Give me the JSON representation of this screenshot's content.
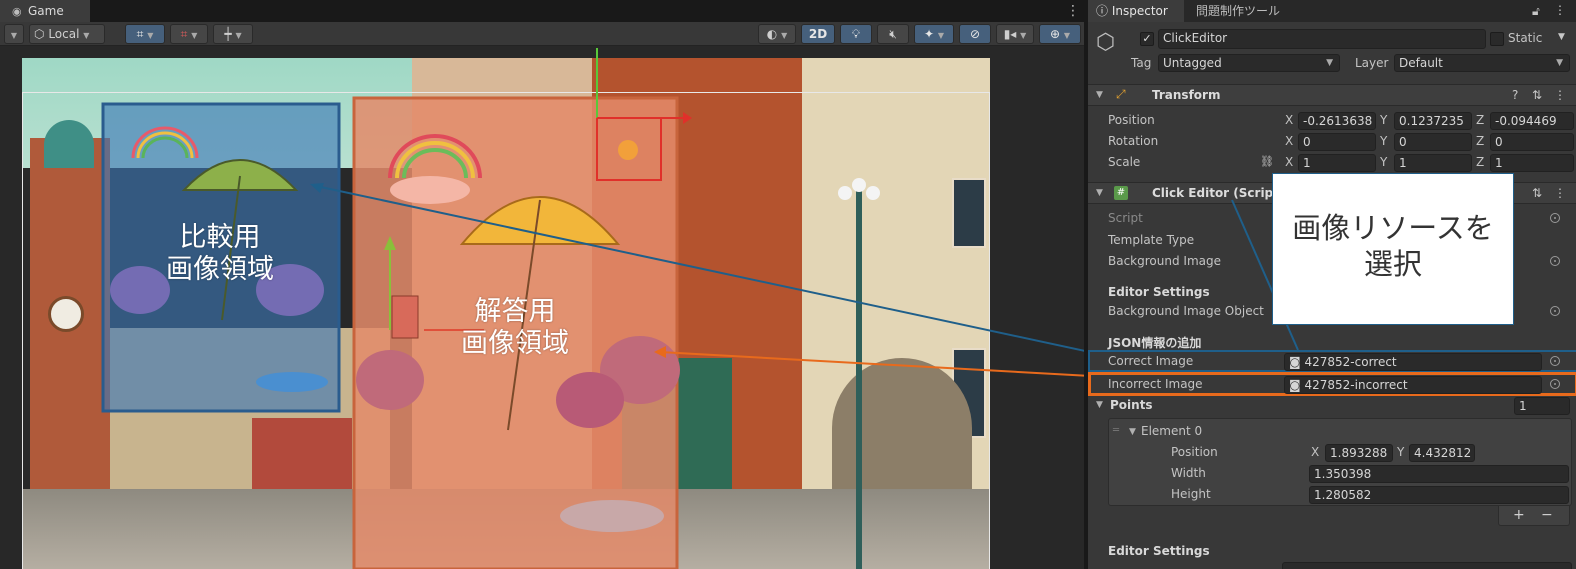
{
  "game": {
    "tab_label": "Game",
    "toolbar": {
      "space_label": "Local",
      "mode_2d_label": "2D"
    },
    "overlays": {
      "comparison_region": "比較用\n画像領域",
      "answer_region": "解答用\n画像領域"
    }
  },
  "inspector": {
    "tabs": [
      "Inspector",
      "問題制作ツール"
    ],
    "object": {
      "name": "ClickEditor",
      "static_label": "Static",
      "tag_label": "Tag",
      "tag_value": "Untagged",
      "layer_label": "Layer",
      "layer_value": "Default"
    },
    "transform": {
      "title": "Transform",
      "position_label": "Position",
      "position": [
        "-0.2613638",
        "0.1237235",
        "-0.094469"
      ],
      "rotation_label": "Rotation",
      "rotation": [
        "0",
        "0",
        "0"
      ],
      "scale_label": "Scale",
      "scale": [
        "1",
        "1",
        "1"
      ]
    },
    "click_editor": {
      "title": "Click Editor (Script)",
      "script_label": "Script",
      "template_type_label": "Template Type",
      "background_image_label": "Background Image",
      "editor_settings_label": "Editor Settings",
      "background_image_object_label": "Background Image Object",
      "json_section_label": "JSON情報の追加",
      "correct_image_label": "Correct Image",
      "correct_image_value": "427852-correct",
      "incorrect_image_label": "Incorrect Image",
      "incorrect_image_value": "427852-incorrect",
      "points_label": "Points",
      "points_count": "1",
      "element0": {
        "label": "Element 0",
        "position_label": "Position",
        "x": "1.893288",
        "y": "4.432812",
        "width_label": "Width",
        "width": "1.350398",
        "height_label": "Height",
        "height": "1.280582"
      },
      "add_label": "+",
      "remove_label": "−",
      "editor_settings_label_2": "Editor Settings"
    },
    "axis_labels": [
      "X",
      "Y",
      "Z"
    ]
  },
  "annotation": {
    "callout_text": "画像リソースを\n選択",
    "blue_color": "#1f5f8a",
    "orange_color": "#e86a1c"
  }
}
